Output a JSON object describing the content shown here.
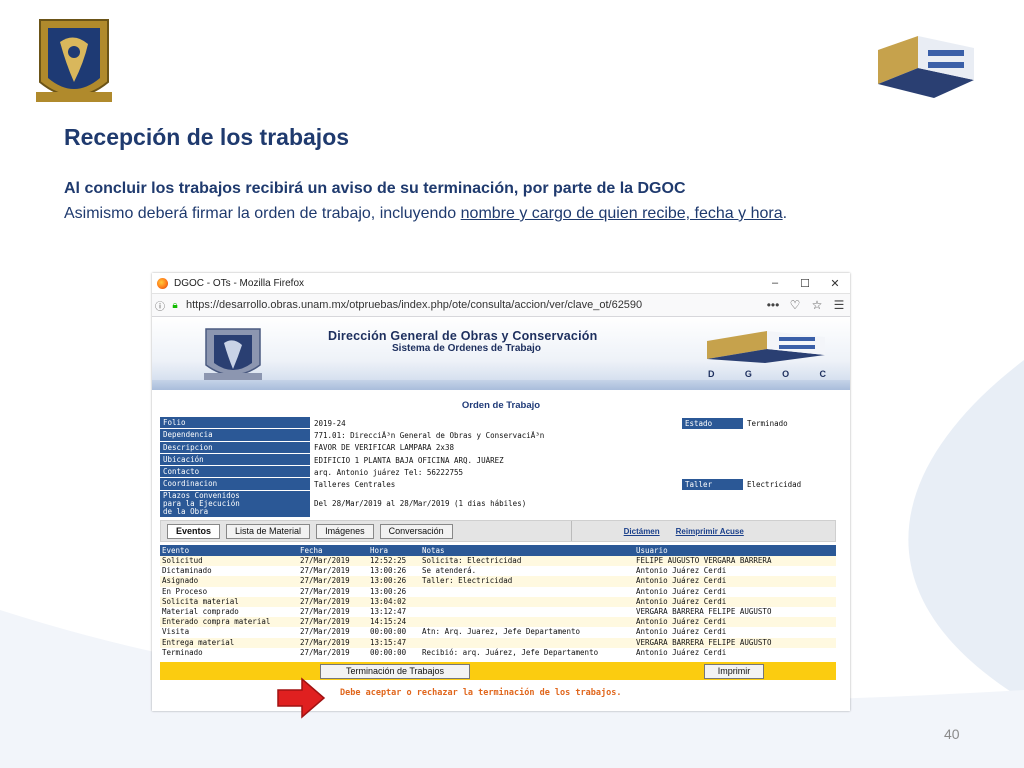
{
  "slide": {
    "title": "Recepción de los trabajos",
    "line1": "Al concluir los trabajos recibirá un aviso de su terminación, por parte de la DGOC",
    "line2_prefix": "Asimismo deberá firmar la orden de trabajo, incluyendo ",
    "line2_underlined": "nombre y cargo de quien recibe, fecha y hora",
    "line2_suffix": ".",
    "page_number": "40"
  },
  "browser": {
    "window_title": "DGOC - OTs - Mozilla Firefox",
    "url": "https://desarrollo.obras.unam.mx/otpruebas/index.php/ote/consulta/accion/ver/clave_ot/62590",
    "controls": [
      "–",
      "☐",
      "✕"
    ]
  },
  "app": {
    "header_title": "Dirección General de Obras y Conservación",
    "header_subtitle": "Sistema de Ordenes de Trabajo",
    "dgoc_letters": [
      "D",
      "G",
      "O",
      "C"
    ],
    "section_title": "Orden de Trabajo",
    "fields": [
      {
        "label": "Folio",
        "value": "2019-24",
        "right_label": "Estado",
        "right_value": "Terminado"
      },
      {
        "label": "Dependencia",
        "value": "771.01: DirecciÃ³n General de Obras y ConservaciÃ³n"
      },
      {
        "label": "Descripcion",
        "value": "FAVOR DE VERIFICAR LAMPARA 2x38"
      },
      {
        "label": "Ubicación",
        "value": "EDIFICIO 1 PLANTA BAJA OFICINA ARQ. JUÁREZ"
      },
      {
        "label": "Contacto",
        "value": "arq. Antonio juárez Tel: 56222755"
      },
      {
        "label": "Coordinacion",
        "value": "Talleres Centrales",
        "right_label": "Taller",
        "right_value": "Electricidad"
      }
    ],
    "plazos": {
      "label": "Plazos Convenidos\npara la Ejecución\nde la Obra",
      "value": "Del 28/Mar/2019 al 28/Mar/2019 (1 dias hábiles)"
    },
    "tabs": [
      "Eventos",
      "Lista de Material",
      "Imágenes",
      "Conversación"
    ],
    "links": [
      "Dictámen",
      "Reimprimir Acuse"
    ],
    "events_headers": [
      "Evento",
      "Fecha",
      "Hora",
      "Notas",
      "Usuario"
    ],
    "events": [
      [
        "Solicitud",
        "27/Mar/2019",
        "12:52:25",
        "Solicita: Electricidad",
        "FELIPE AUGUSTO VERGARA BARRERA"
      ],
      [
        "Dictaminado",
        "27/Mar/2019",
        "13:00:26",
        "Se atenderá.",
        "Antonio Juárez Cerdi"
      ],
      [
        "Asignado",
        "27/Mar/2019",
        "13:00:26",
        "Taller: Electricidad",
        "Antonio Juárez Cerdi"
      ],
      [
        "En Proceso",
        "27/Mar/2019",
        "13:00:26",
        "",
        "Antonio Juárez Cerdi"
      ],
      [
        "Solicita material",
        "27/Mar/2019",
        "13:04:02",
        "",
        "Antonio Juárez Cerdi"
      ],
      [
        "Material comprado",
        "27/Mar/2019",
        "13:12:47",
        "",
        "VERGARA BARRERA FELIPE AUGUSTO"
      ],
      [
        "Enterado compra material",
        "27/Mar/2019",
        "14:15:24",
        "",
        "Antonio Juárez Cerdi"
      ],
      [
        "Visita",
        "27/Mar/2019",
        "00:00:00",
        "Atn: Arq. Juarez, Jefe Departamento",
        "Antonio Juárez Cerdi"
      ],
      [
        "Entrega material",
        "27/Mar/2019",
        "13:15:47",
        "",
        "VERGARA BARRERA FELIPE AUGUSTO"
      ],
      [
        "Terminado",
        "27/Mar/2019",
        "00:00:00",
        "Recibió: arq. Juárez, Jefe Departamento",
        "Antonio Juárez Cerdi"
      ]
    ],
    "terminacion_button": "Terminación de Trabajos",
    "imprimir_button": "Imprimir",
    "note": "Debe aceptar o rechazar la terminación de los trabajos."
  },
  "colors": {
    "title_blue": "#1f3a6e",
    "table_header": "#2b5896",
    "action_yellow": "#fbcc10",
    "note_orange": "#e0661c",
    "arrow_red": "#e02020"
  }
}
